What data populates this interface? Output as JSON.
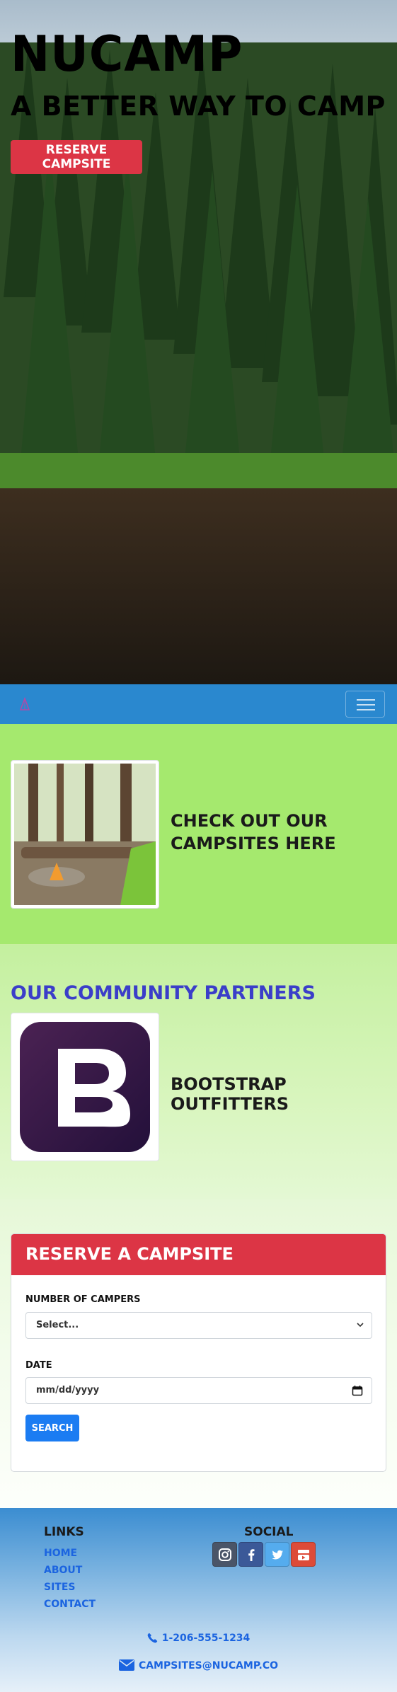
{
  "hero": {
    "title": "NuCamp",
    "subtitle": "A Better Way to Camp",
    "reserve_button": "Reserve Campsite"
  },
  "navbar": {
    "brand_icon": "tent-icon",
    "toggler_icon": "hamburger-menu-icon"
  },
  "campsites": {
    "text": "Check out our campsites here"
  },
  "partners": {
    "heading": "Our Community Partners",
    "items": [
      {
        "name": "Bootstrap Outfitters",
        "logo": "bootstrap-logo"
      }
    ]
  },
  "reserve": {
    "header": "Reserve a Campsite",
    "campers_label": "Number of Campers",
    "campers_selected": "Select...",
    "date_label": "Date",
    "date_placeholder": "mm/dd/yyyy",
    "search_button": "Search"
  },
  "footer": {
    "links_heading": "Links",
    "links": [
      "Home",
      "About",
      "Sites",
      "Contact"
    ],
    "social_heading": "Social",
    "social": [
      {
        "name": "instagram-icon",
        "color": "#4a5568"
      },
      {
        "name": "facebook-icon",
        "color": "#3b5998"
      },
      {
        "name": "twitter-icon",
        "color": "#55acee"
      },
      {
        "name": "youtube-icon",
        "color": "#dd4b39"
      }
    ],
    "phone": "1-206-555-1234",
    "email": "campsites@nucamp.co"
  },
  "colors": {
    "accent_red": "#dc3545",
    "navbar_blue": "#2a88cf",
    "partners_heading": "#3b3ec9",
    "link_blue": "#1b64e0",
    "button_blue": "#1b7cf2"
  }
}
